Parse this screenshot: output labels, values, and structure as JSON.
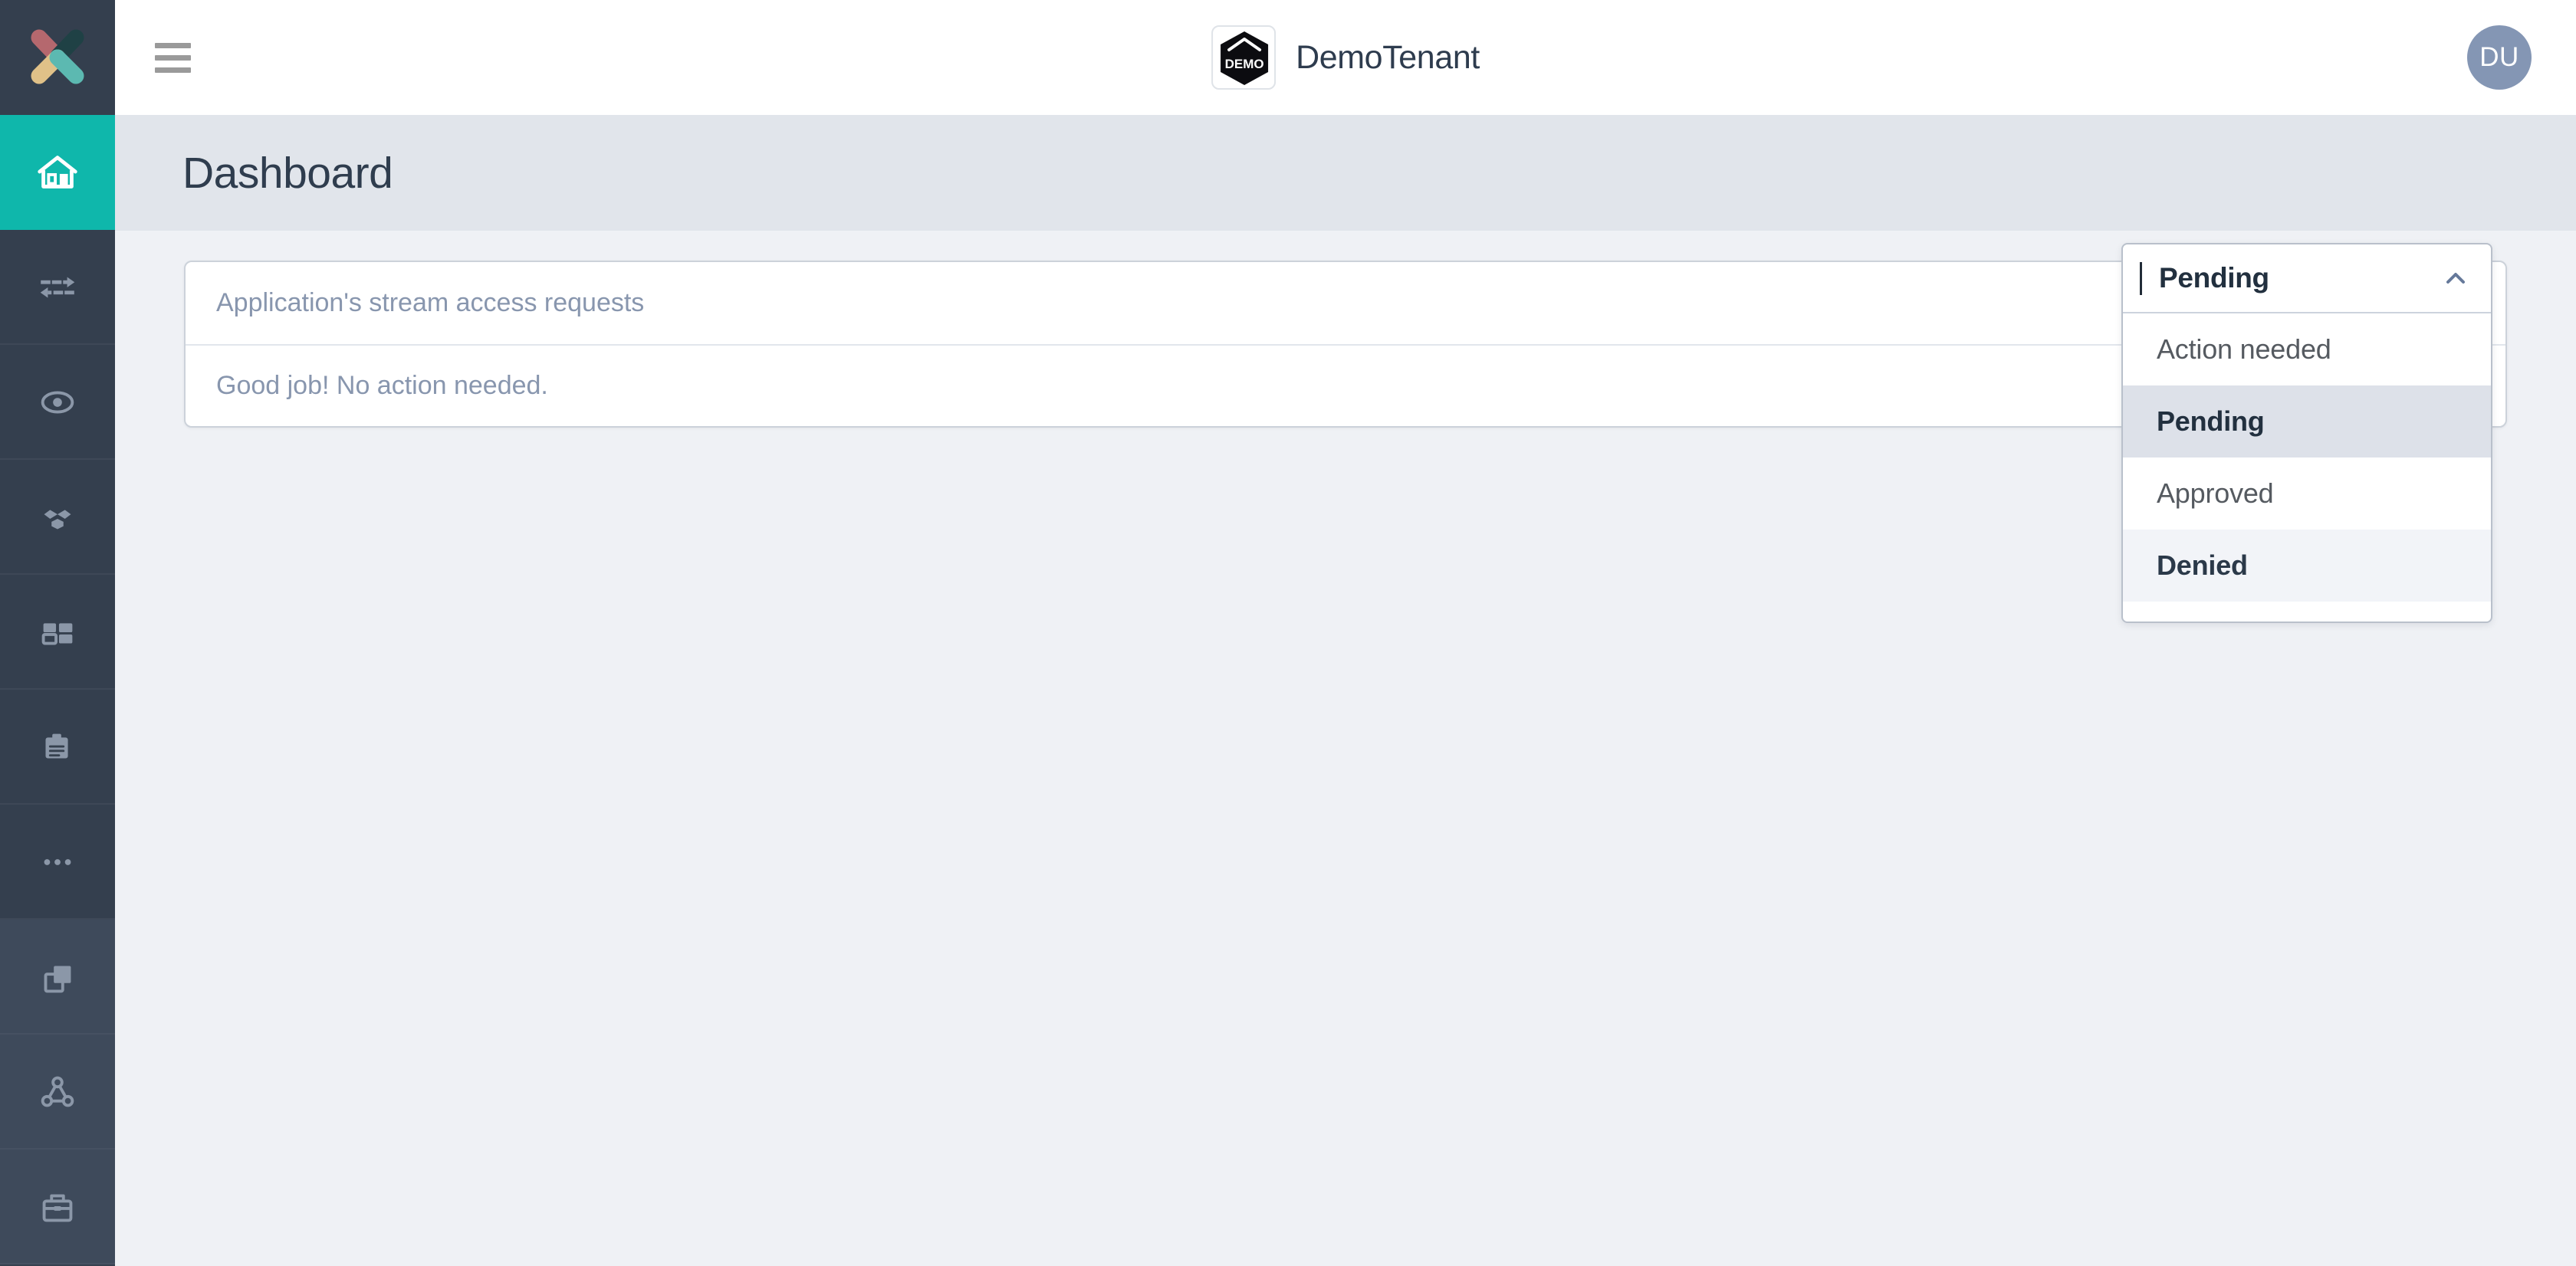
{
  "app": {
    "logo_icon": "x-brand-logo",
    "logo_colors": [
      "#b5686e",
      "#1f4145",
      "#e0c188",
      "#5cb9b1"
    ]
  },
  "topbar": {
    "menu_icon": "hamburger-menu-icon",
    "tenant_logo_icon": "demo-hexagon-logo",
    "tenant_logo_text": "DEMO",
    "tenant_name": "DemoTenant",
    "avatar_initials": "DU"
  },
  "page": {
    "title": "Dashboard"
  },
  "sidebar": {
    "items": [
      {
        "icon": "home-icon",
        "name": "home",
        "active": true
      },
      {
        "icon": "bidirectional-arrows-icon",
        "name": "streams"
      },
      {
        "icon": "eye-target-icon",
        "name": "monitoring"
      },
      {
        "icon": "topology-nodes-icon",
        "name": "topology"
      },
      {
        "icon": "dashboard-grid-icon",
        "name": "dashboards"
      },
      {
        "icon": "clipboard-icon",
        "name": "reports"
      },
      {
        "icon": "ellipsis-icon",
        "name": "more"
      },
      {
        "icon": "copy-windows-icon",
        "name": "applications"
      },
      {
        "icon": "triangle-graph-icon",
        "name": "graph"
      },
      {
        "icon": "toolbox-icon",
        "name": "toolbox"
      }
    ]
  },
  "card": {
    "title": "Application's stream access requests",
    "message": "Good job! No action needed."
  },
  "dropdown": {
    "selected": "Pending",
    "chevron_icon": "chevron-up-icon",
    "options": [
      {
        "label": "Action needed",
        "state": "normal"
      },
      {
        "label": "Pending",
        "state": "selected"
      },
      {
        "label": "Approved",
        "state": "normal"
      },
      {
        "label": "Denied",
        "state": "alt"
      }
    ]
  },
  "colors": {
    "accent_teal": "#0fb7ab",
    "sidebar_dark": "#343f4e",
    "sidebar_light": "#3e4a5b",
    "page_background": "#eff1f5",
    "titlebar_background": "#e1e5eb",
    "muted_text": "#8896ae",
    "avatar_background": "#8496b4"
  }
}
